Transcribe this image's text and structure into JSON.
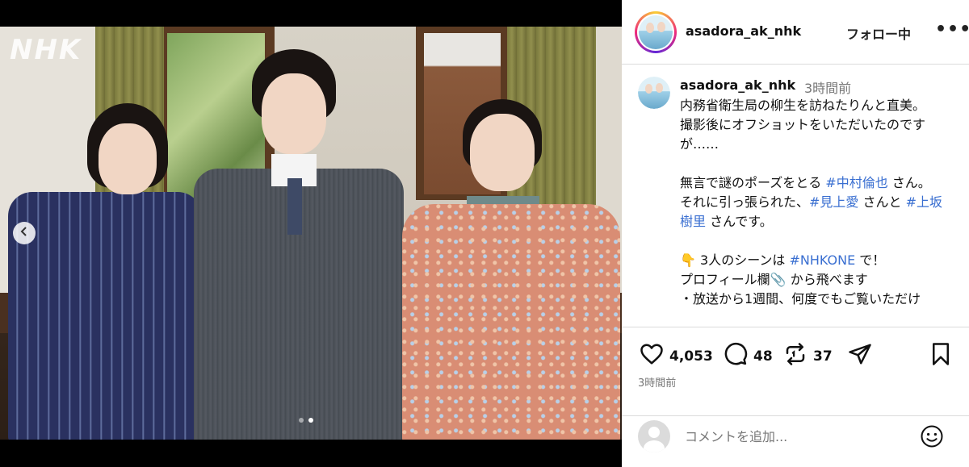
{
  "media": {
    "logo_text": "NHK",
    "carousel": {
      "current": 2,
      "total": 2
    }
  },
  "header": {
    "username": "asadora_ak_nhk",
    "follow_label": "フォロー中",
    "more_label": "•••"
  },
  "caption": {
    "username": "asadora_ak_nhk",
    "time": "3時間前",
    "line1": "内務省衛生局の柳生を訪ねたりんと直美。",
    "line2": "撮影後にオフショットをいただいたのですが……",
    "line3_pre": "無言で謎のポーズをとる ",
    "tag1": "#中村倫也",
    "line3_post": " さん。",
    "line4_pre": "それに引っ張られた、",
    "tag2": "#見上愛",
    "line4_mid": " さんと ",
    "tag3": "#上坂樹里",
    "line4_post": " さんです。",
    "line5_pre": "👇 3人のシーンは ",
    "tag4": "#NHKONE",
    "line5_post": " で！",
    "line6": "プロフィール欄📎 から飛べます",
    "line7": "・放送から1週間、何度でもご覧いただけ"
  },
  "actions": {
    "likes": "4,053",
    "comments": "48",
    "reposts": "37",
    "posted": "3時間前"
  },
  "comment_box": {
    "placeholder": "コメントを追加..."
  },
  "colors": {
    "hashtag": "#3a6fd1",
    "border": "#dbdbdb",
    "muted": "#777777"
  },
  "icons": [
    "chevron-left-icon",
    "heart-icon",
    "comment-icon",
    "repost-icon",
    "share-icon",
    "bookmark-icon",
    "emoji-icon"
  ]
}
